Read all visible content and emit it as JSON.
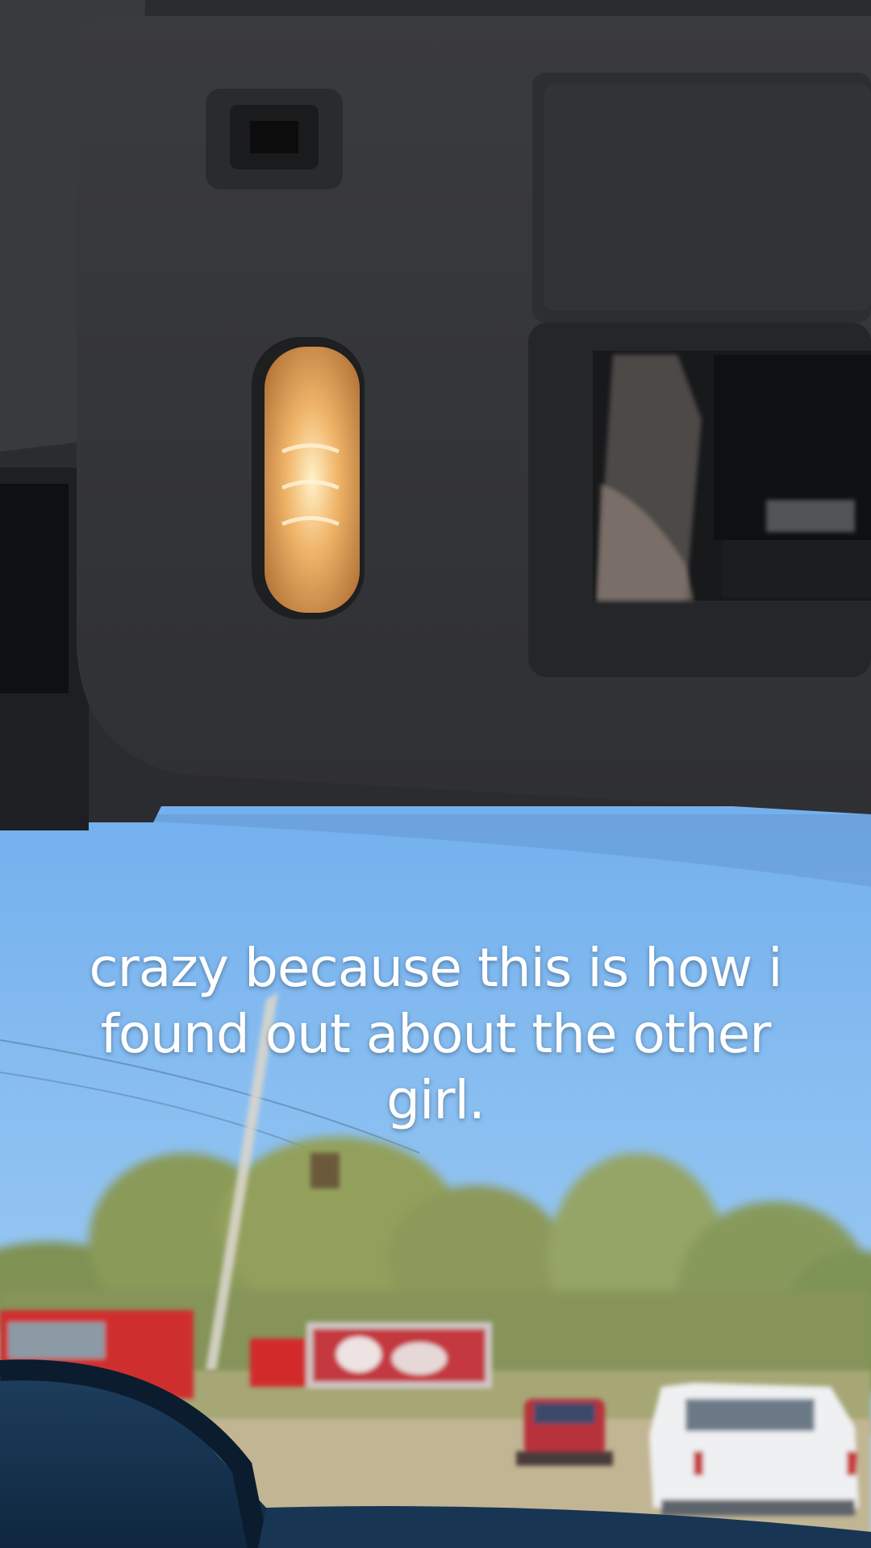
{
  "caption": {
    "text": "crazy because this is how i found out about the other girl."
  },
  "colors": {
    "sky_top": "#5f9fe4",
    "sky_bottom": "#8cc0f0",
    "visor": "#38393c",
    "headliner": "#2b2c2f",
    "trees": "#8f9c5a",
    "road": "#b9ad8e",
    "dome_light": "#e8a65a"
  }
}
